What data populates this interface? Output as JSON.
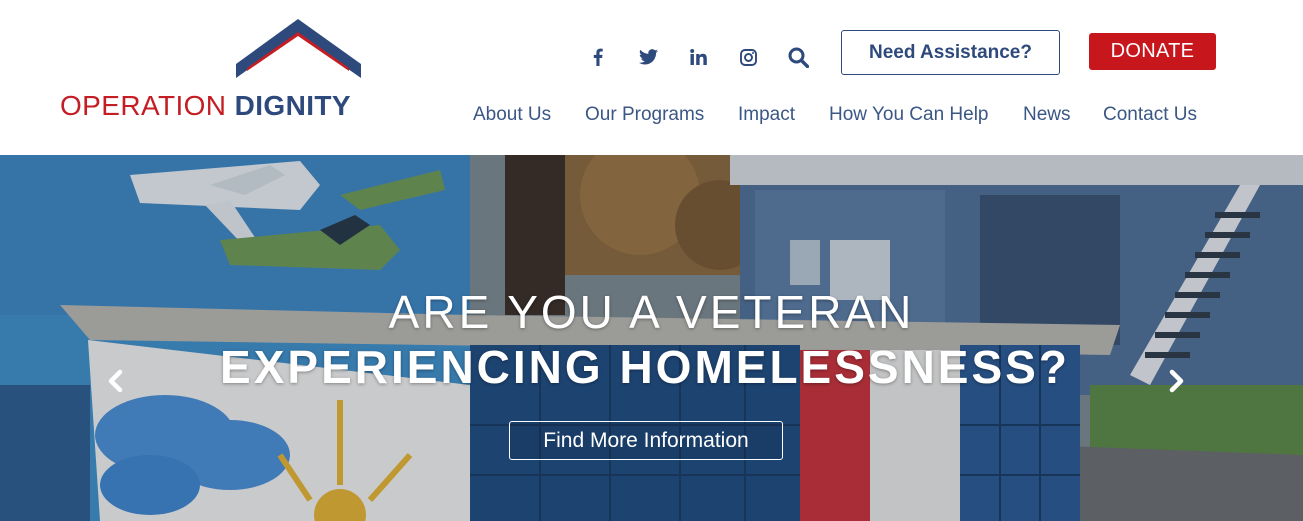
{
  "logo": {
    "text_part1": "OPERATION",
    "text_part2": "DIGNITY",
    "red": "#c41e24",
    "blue": "#2e4a7d"
  },
  "social": [
    {
      "icon": "facebook-icon"
    },
    {
      "icon": "twitter-icon"
    },
    {
      "icon": "linkedin-icon"
    },
    {
      "icon": "instagram-icon"
    },
    {
      "icon": "search-icon"
    }
  ],
  "header": {
    "assist_label": "Need Assistance?",
    "donate_label": "DONATE",
    "donate_color": "#c8161d"
  },
  "nav": {
    "items": [
      {
        "label": "About Us"
      },
      {
        "label": "Our Programs"
      },
      {
        "label": "Impact"
      },
      {
        "label": "How You Can Help"
      },
      {
        "label": "News"
      },
      {
        "label": "Contact Us"
      }
    ]
  },
  "hero": {
    "line1": "ARE YOU A VETERAN",
    "line2": "EXPERIENCING HOMELESSNESS?",
    "cta_label": "Find More Information",
    "prev_icon": "chevron-left-icon",
    "next_icon": "chevron-right-icon"
  }
}
